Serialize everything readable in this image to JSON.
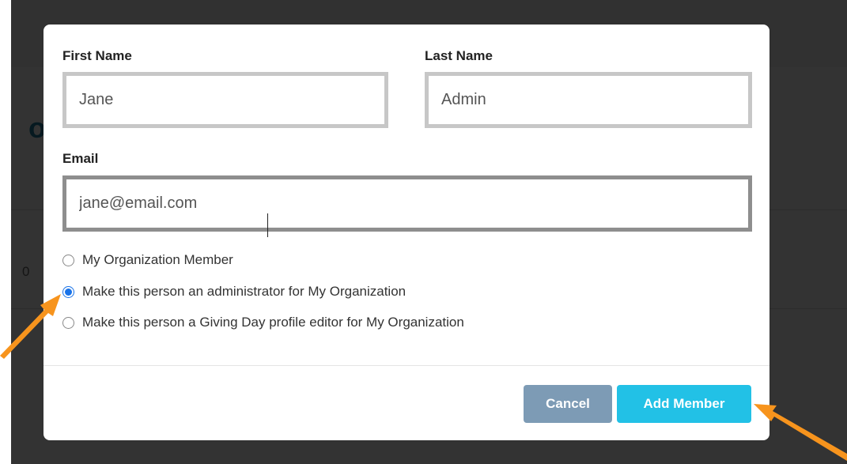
{
  "background": {
    "title_fragment": "oa",
    "number_fragment": "0"
  },
  "modal": {
    "first_name_label": "First Name",
    "first_name_value": "Jane",
    "last_name_label": "Last Name",
    "last_name_value": "Admin",
    "email_label": "Email",
    "email_value": "jane@email.com",
    "roles": [
      {
        "label": "My Organization Member",
        "checked": false
      },
      {
        "label": "Make this person an administrator for My Organization",
        "checked": true
      },
      {
        "label": "Make this person a Giving Day profile editor for My Organization",
        "checked": false
      }
    ],
    "cancel_label": "Cancel",
    "add_label": "Add Member"
  },
  "colors": {
    "overlay": "#000000",
    "accent_add": "#22c1e6",
    "cancel": "#7d9bb5",
    "radio_checked": "#1a73e8",
    "arrow": "#f7941d",
    "title_fragment": "#1f7ea1"
  }
}
